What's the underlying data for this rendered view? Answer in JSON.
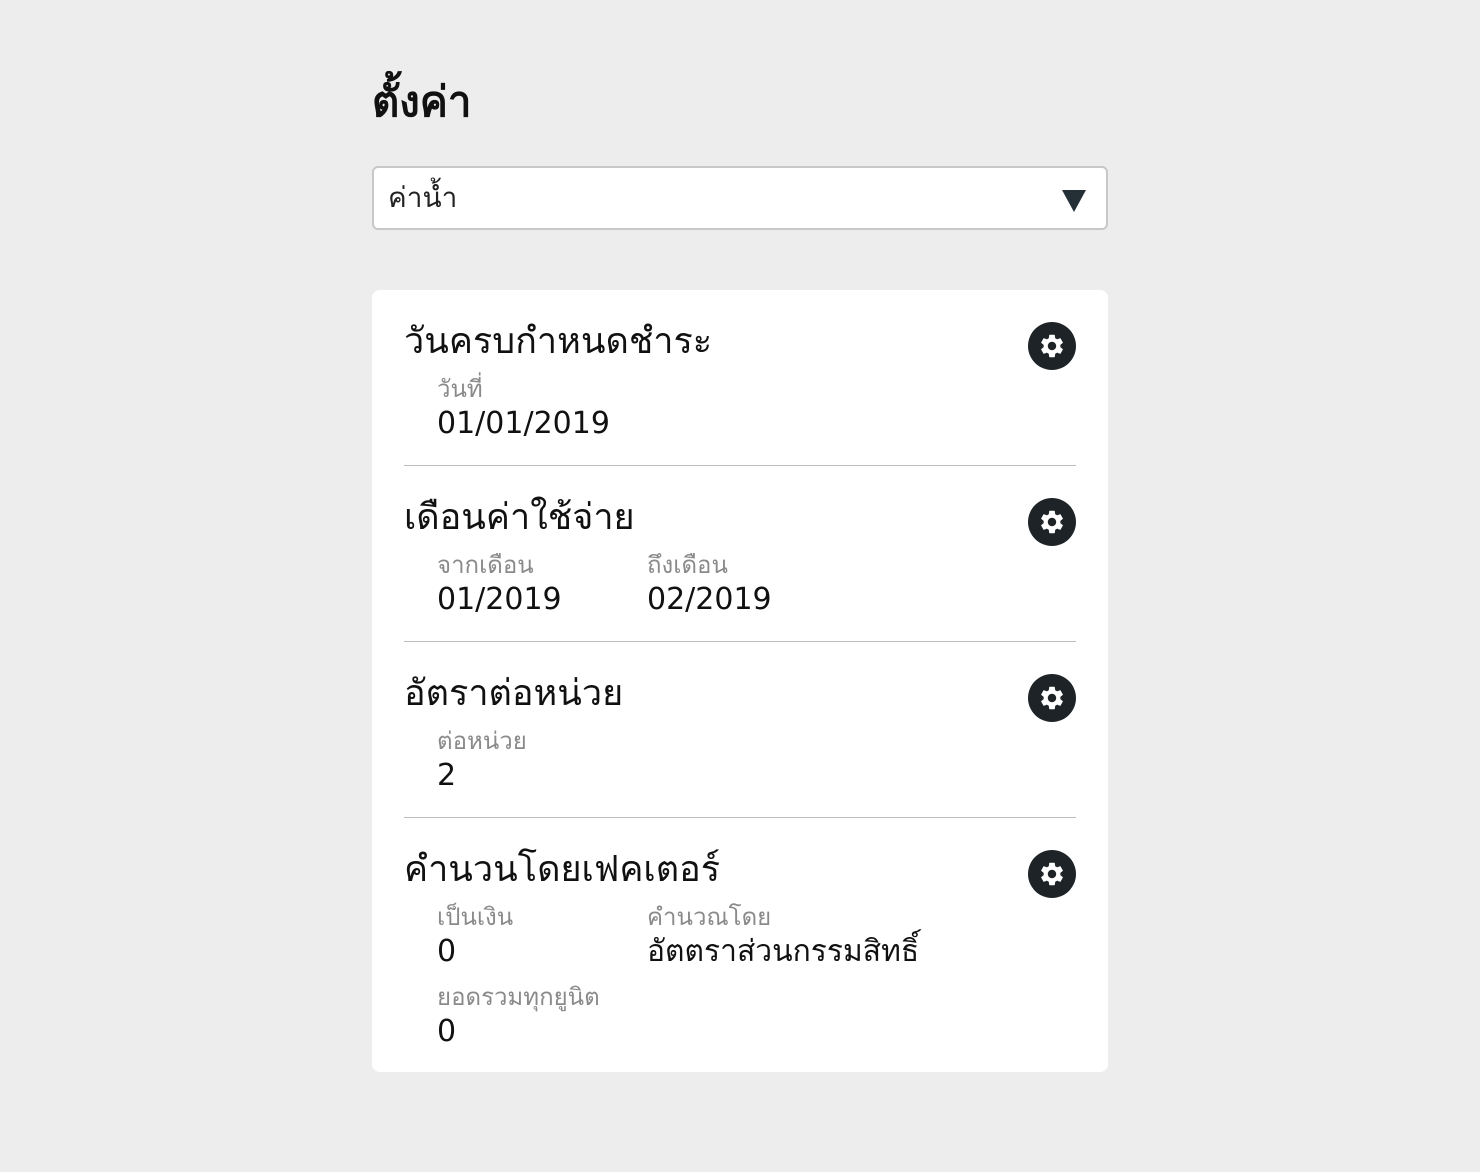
{
  "page": {
    "title": "ตั้งค่า"
  },
  "select": {
    "value": "ค่าน้ำ",
    "icon": "chevron-down-icon"
  },
  "sections": [
    {
      "title": "วันครบกำหนดชำระ",
      "icon": "gear-icon",
      "fields": [
        {
          "label": "วันที่",
          "value": "01/01/2019"
        }
      ]
    },
    {
      "title": "เดือนค่าใช้จ่าย",
      "icon": "gear-icon",
      "fields": [
        {
          "label": "จากเดือน",
          "value": "01/2019"
        },
        {
          "label": "ถึงเดือน",
          "value": "02/2019"
        }
      ]
    },
    {
      "title": "อัตราต่อหน่วย",
      "icon": "gear-icon",
      "fields": [
        {
          "label": "ต่อหน่วย",
          "value": "2"
        }
      ]
    },
    {
      "title": "คำนวนโดยเฟคเตอร์",
      "icon": "gear-icon",
      "fields": [
        {
          "label": "เป็นเงิน",
          "value": "0"
        },
        {
          "label": "คำนวณโดย",
          "value": "อัตตราส่วนกรรมสิทธิ์"
        },
        {
          "label": "ยอดรวมทุกยูนิต",
          "value": "0"
        }
      ]
    }
  ],
  "colors": {
    "background": "#ededed",
    "card": "#ffffff",
    "gear_button": "#1d2326",
    "label": "#8a8a8a"
  }
}
